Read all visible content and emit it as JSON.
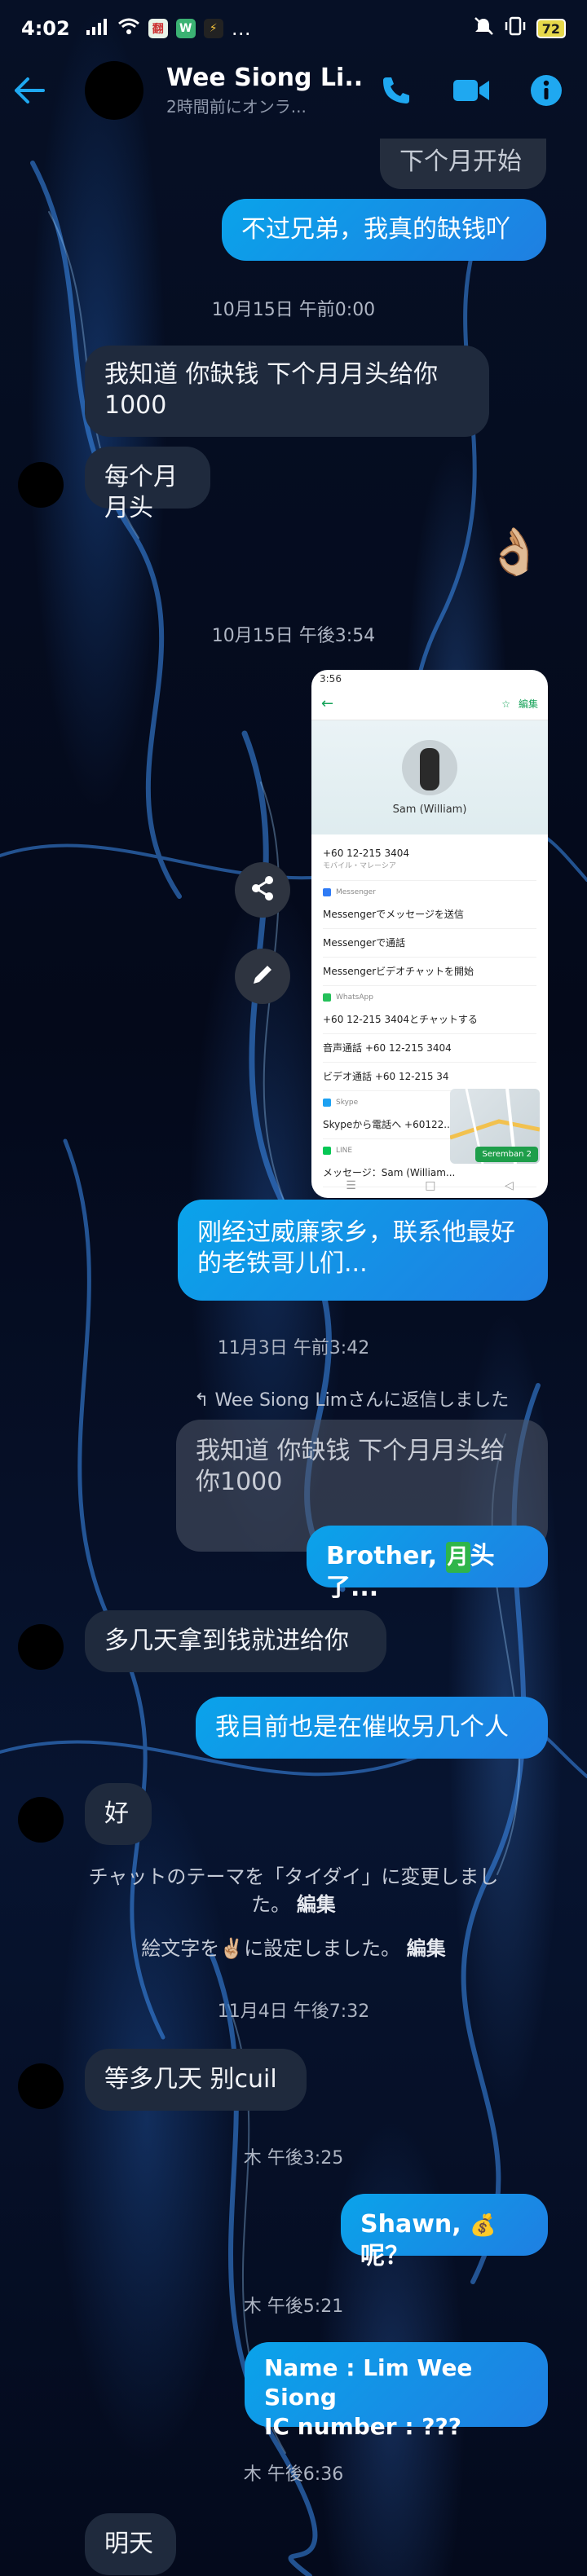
{
  "status_bar": {
    "time": "4:02",
    "battery": "72",
    "more": "…"
  },
  "header": {
    "name": "Wee Siong Li...",
    "subtitle": "2時間前にオンラ...",
    "colors": {
      "accent": "#1fa8f0"
    }
  },
  "messages": {
    "m1": "下个月开始",
    "m2": "不过兄弟，我真的缺钱吖",
    "ts1": "10月15日 午前0:00",
    "m3": "我知道 你缺钱 下个月月头给你1000",
    "m4": "每个月月头",
    "m5": "👌🏼",
    "ts2": "10月15日 午後3:54",
    "m6": "刚经过威廉家乡，联系他最好的老铁哥儿们...",
    "ts3": "11月3日 午前3:42",
    "reply_note": "Wee Siong Limさんに返信しました",
    "quoted": "我知道 你缺钱 下个月月头给你1000",
    "m7_pre": "Brother, ",
    "m7_emoji": "月",
    "m7_post": "头了...",
    "m8": "多几天拿到钱就进给你",
    "m9": "我目前也是在催收另几个人",
    "m10": "好",
    "sys1": "チャットのテーマを「タイダイ」に変更しました。",
    "sys1_edit": "編集",
    "sys2_pre": "絵文字を",
    "sys2_emoji": "✌🏼",
    "sys2_post": "に設定しました。",
    "sys2_edit": "編集",
    "ts4": "11月4日 午後7:32",
    "m11": "等多几天 别cuil",
    "ts5": "木 午後3:25",
    "m12_pre": "Shawn, ",
    "m12_emoji": "💰",
    "m12_post": "呢？",
    "ts6": "木 午後5:21",
    "m13": "Name : Lim Wee Siong\nIC number : ???",
    "ts7": "木 午後6:36",
    "m14": "明天"
  },
  "screenshot": {
    "status": "3:56",
    "nav_edit": "編集",
    "name": "Sam (William)",
    "phone": "+60 12-215 3404",
    "phone_sub": "モバイル・マレーシア",
    "sec_messenger": "Messenger",
    "r1": "Messengerでメッセージを送信",
    "r2": "Messengerで通話",
    "r3": "Messengerビデオチャットを開始",
    "sec_whatsapp": "WhatsApp",
    "r4": "+60 12-215 3404とチャットする",
    "r5": "音声通話 +60 12-215 3404",
    "r6": "ビデオ通話 +60 12-215 34",
    "sec_skype": "Skype",
    "r7": "Skypeから電話へ +60122...",
    "sec_line": "LINE",
    "r8": "メッセージ：Sam (William...",
    "map_chip": "Seremban 2"
  }
}
